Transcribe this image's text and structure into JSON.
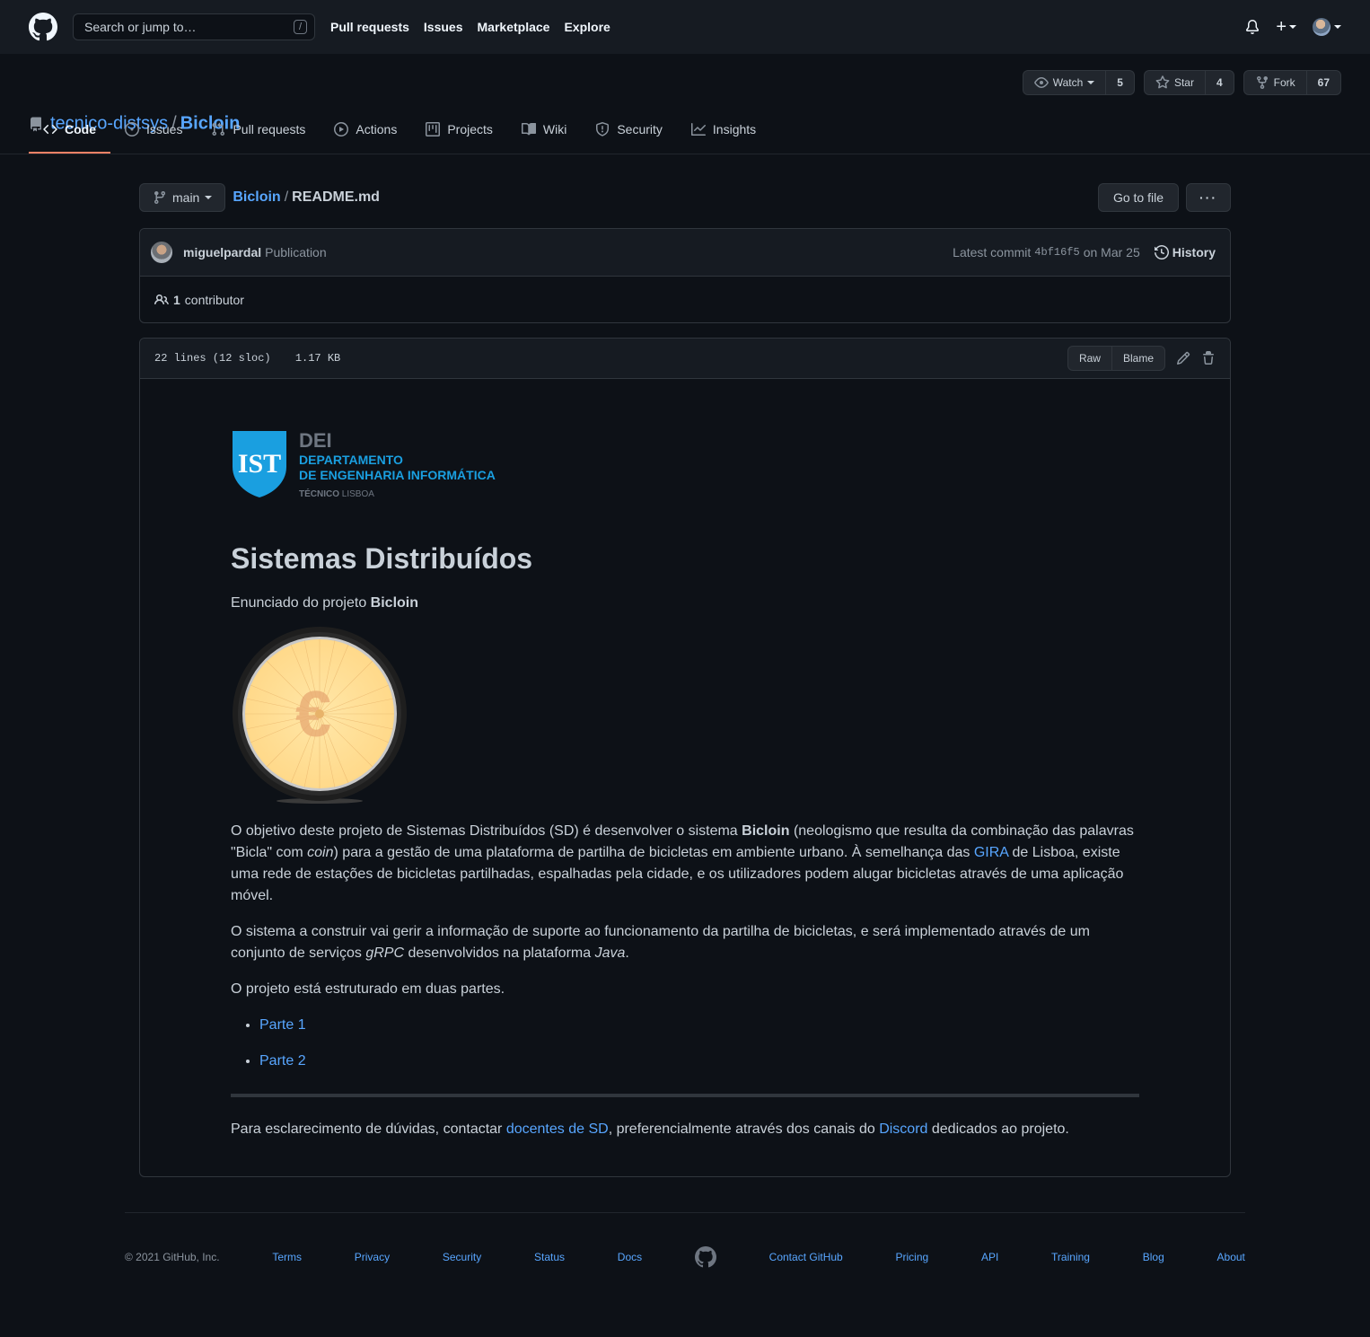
{
  "header": {
    "search_placeholder": "Search or jump to…",
    "search_key": "/",
    "nav": [
      "Pull requests",
      "Issues",
      "Marketplace",
      "Explore"
    ]
  },
  "repo": {
    "owner": "tecnico-distsys",
    "separator": "/",
    "name": "Bicloin",
    "watch_label": "Watch",
    "watch_count": "5",
    "star_label": "Star",
    "star_count": "4",
    "fork_label": "Fork",
    "fork_count": "67",
    "tabs": [
      "Code",
      "Issues",
      "Pull requests",
      "Actions",
      "Projects",
      "Wiki",
      "Security",
      "Insights"
    ],
    "active_tab": "Code"
  },
  "path": {
    "branch": "main",
    "repo": "Bicloin",
    "separator": "/",
    "file": "README.md",
    "go_to_file": "Go to file",
    "more": "···"
  },
  "commit": {
    "author": "miguelpardal",
    "message": "Publication",
    "latest_label": "Latest commit",
    "sha": "4bf16f5",
    "date": "on Mar 25",
    "history_label": "History",
    "contributors_count": "1",
    "contributors_label": "contributor"
  },
  "file": {
    "lines": "22 lines (12 sloc)",
    "size": "1.17 KB",
    "raw": "Raw",
    "blame": "Blame"
  },
  "readme": {
    "logo": {
      "abbr": "DEI",
      "line1": "DEPARTAMENTO",
      "line2": "DE ENGENHARIA INFORMÁTICA",
      "inst_bold": "TÉCNICO",
      "inst_rest": "LISBOA"
    },
    "title": "Sistemas Distribuídos",
    "intro_text": "Enunciado do projeto ",
    "intro_bold": "Bicloin",
    "p1": {
      "a": "O objetivo deste projeto de Sistemas Distribuídos (SD) é desenvolver o sistema ",
      "b": "Bicloin",
      "c": " (neologismo que resulta da combinação das palavras \"Bicla\" com ",
      "d": "coin",
      "e": ") para a gestão de uma plataforma de partilha de bicicletas em ambiente urbano. À semelhança das ",
      "link": "GIRA",
      "f": " de Lisboa, existe uma rede de estações de bicicletas partilhadas, espalhadas pela cidade, e os utilizadores podem alugar bicicletas através de uma aplicação móvel."
    },
    "p2": {
      "a": "O sistema a construir vai gerir a informação de suporte ao funcionamento da partilha de bicicletas, e será implementado através de um conjunto de serviços ",
      "b": "gRPC",
      "c": " desenvolvidos na plataforma ",
      "d": "Java",
      "e": "."
    },
    "p3": "O projeto está estruturado em duas partes.",
    "list": [
      "Parte 1",
      "Parte 2"
    ],
    "p4": {
      "a": "Para esclarecimento de dúvidas, contactar ",
      "link1": "docentes de SD",
      "b": ", preferencialmente através dos canais do ",
      "link2": "Discord",
      "c": " dedicados ao projeto."
    }
  },
  "footer": {
    "copyright": "© 2021 GitHub, Inc.",
    "left_links": [
      "Terms",
      "Privacy",
      "Security",
      "Status",
      "Docs"
    ],
    "right_links": [
      "Contact GitHub",
      "Pricing",
      "API",
      "Training",
      "Blog",
      "About"
    ]
  },
  "colors": {
    "background": "#0d1117",
    "header": "#161b22",
    "link": "#58a6ff",
    "active_tab_underline": "#f78166",
    "logo_blue": "#1a9fe0"
  }
}
